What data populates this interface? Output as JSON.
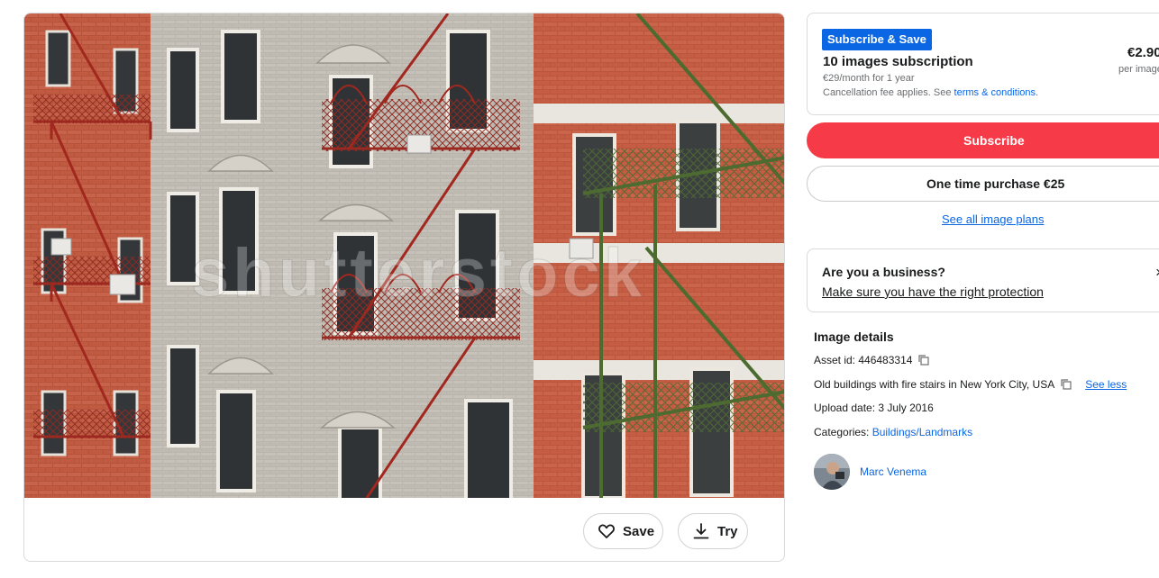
{
  "image": {
    "alt": "Old buildings with fire stairs in New York City, USA",
    "watermark": "shutterstock"
  },
  "actions": {
    "save_label": "Save",
    "try_label": "Try"
  },
  "plan": {
    "badge": "Subscribe & Save",
    "title": "10 images subscription",
    "subtitle": "€29/month for 1 year",
    "fee_prefix": "Cancellation fee applies. See ",
    "fee_link": "terms & conditions",
    "fee_suffix": ".",
    "price": "€2.90",
    "per": "per image"
  },
  "buttons": {
    "subscribe": "Subscribe",
    "one_time": "One time purchase €25",
    "see_all": "See all image plans"
  },
  "business": {
    "title": "Are you a business?",
    "link": "Make sure you have the right protection",
    "close": "×"
  },
  "details": {
    "title": "Image details",
    "asset_label": "Asset id: ",
    "asset_id": "446483314",
    "description": "Old buildings with fire stairs in New York City, USA",
    "see_less": "See less",
    "upload_label": "Upload date: ",
    "upload_date": "3 July 2016",
    "categories_label": "Categories: ",
    "category": "Buildings/Landmarks"
  },
  "author": {
    "name": "Marc Venema"
  },
  "colors": {
    "accent_blue": "#0b66e4",
    "subscribe_red": "#f73a48",
    "border": "#d9dadc"
  }
}
